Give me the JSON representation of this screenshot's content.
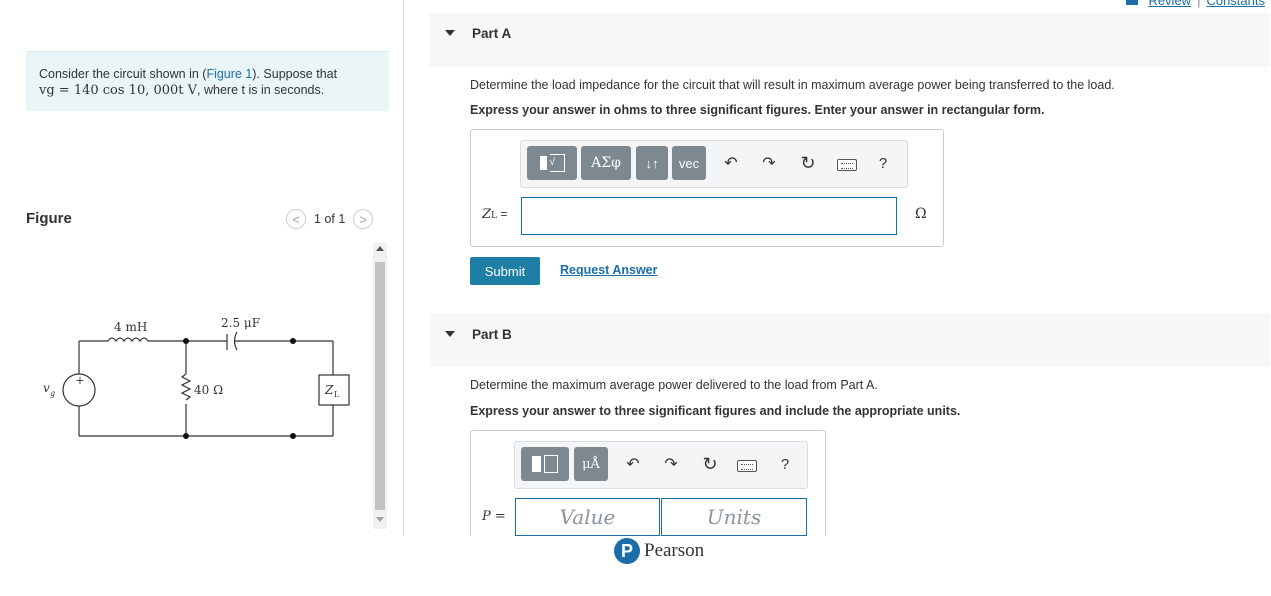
{
  "top_links": {
    "review": "Review",
    "separator": "|",
    "constants": "Constants"
  },
  "problem": {
    "text_before_link": "Consider the circuit shown in (",
    "figure_link": "Figure 1",
    "text_after_link": "). Suppose that",
    "equation": "vg = 140 cos 10, 000t V",
    "text_end": ", where t is in seconds."
  },
  "figure": {
    "heading": "Figure",
    "page_indicator": "1 of 1",
    "prev_symbol": "<",
    "next_symbol": ">",
    "labels": {
      "inductor": "4 mH",
      "capacitor": "2.5 μF",
      "resistor": "40 Ω",
      "load": "Z",
      "load_sub": "L",
      "source": "v",
      "source_sub": "g",
      "plus": "+"
    }
  },
  "part_a": {
    "title": "Part A",
    "question": "Determine the load impedance for the circuit that will result in maximum average power being transferred to the load.",
    "instruction": "Express your answer in ohms to three significant figures. Enter your answer in rectangular form.",
    "toolbar": {
      "greek": "ΑΣφ",
      "arrows": "↓↑",
      "vec": "vec",
      "help": "?"
    },
    "input_label": "Z",
    "input_label_sub": "L",
    "input_label_eq": " =",
    "input_value": "",
    "unit": "Ω",
    "submit": "Submit",
    "request_answer": "Request Answer"
  },
  "part_b": {
    "title": "Part B",
    "question": "Determine the maximum average power delivered to the load from Part A.",
    "instruction": "Express your answer to three significant figures and include the appropriate units.",
    "toolbar": {
      "units_symbol": "μÅ",
      "help": "?"
    },
    "input_label": "P =",
    "value_placeholder": "Value",
    "units_placeholder": "Units"
  },
  "footer": {
    "brand": "Pearson",
    "logo_letter": "P"
  }
}
